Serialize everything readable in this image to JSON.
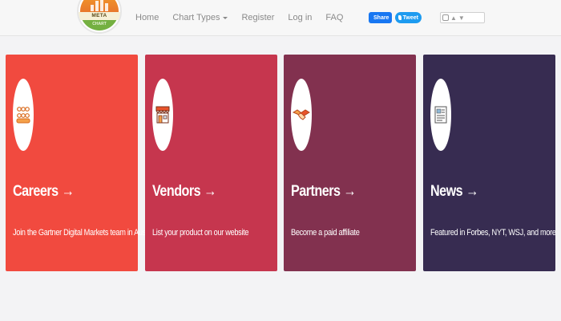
{
  "brand": {
    "logo_text": "META",
    "logo_subtext": "CHART"
  },
  "nav": {
    "items": [
      "Home",
      "Chart Types",
      "Register",
      "Log in",
      "FAQ"
    ]
  },
  "social": {
    "share_label": "Share",
    "tweet_label": "Tweet"
  },
  "cards": [
    {
      "title": "Careers →",
      "desc": "Join the Gartner Digital Markets team in Austin.",
      "color": "#f14a3f",
      "icon": "people-icon"
    },
    {
      "title": "Vendors →",
      "desc": "List your product on our website",
      "color": "#c6364e",
      "icon": "storefront-icon"
    },
    {
      "title": "Partners →",
      "desc": "Become a paid affiliate",
      "color": "#82314f",
      "icon": "handshake-icon"
    },
    {
      "title": "News →",
      "desc": "Featured in Forbes, NYT, WSJ, and more",
      "color": "#372c51",
      "icon": "newspaper-icon"
    }
  ]
}
